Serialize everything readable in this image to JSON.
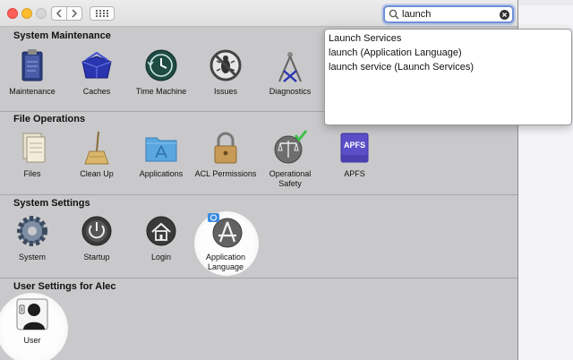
{
  "search": {
    "value": "launch"
  },
  "suggestions": [
    "Launch Services",
    "launch (Application Language)",
    "launch service (Launch Services)"
  ],
  "sections": [
    {
      "title": "System Maintenance",
      "items": [
        {
          "label": "Maintenance",
          "icon": "clipboard-icon"
        },
        {
          "label": "Caches",
          "icon": "caches-box-icon"
        },
        {
          "label": "Time Machine",
          "icon": "time-machine-icon"
        },
        {
          "label": "Issues",
          "icon": "issues-no-bug-icon"
        },
        {
          "label": "Diagnostics",
          "icon": "diagnostics-caliper-icon"
        }
      ]
    },
    {
      "title": "File Operations",
      "items": [
        {
          "label": "Files",
          "icon": "files-icon"
        },
        {
          "label": "Clean Up",
          "icon": "broom-icon"
        },
        {
          "label": "Applications",
          "icon": "applications-folder-icon"
        },
        {
          "label": "ACL Permissions",
          "icon": "padlock-icon"
        },
        {
          "label": "Operational Safety",
          "icon": "scales-check-icon"
        },
        {
          "label": "APFS",
          "icon": "apfs-drive-icon",
          "badge": "APFS"
        }
      ]
    },
    {
      "title": "System Settings",
      "items": [
        {
          "label": "System",
          "icon": "gear-icon"
        },
        {
          "label": "Startup",
          "icon": "power-icon"
        },
        {
          "label": "Login",
          "icon": "home-icon"
        },
        {
          "label": "Application Language",
          "icon": "app-store-language-icon"
        }
      ]
    },
    {
      "title": "User Settings for Alec",
      "items": [
        {
          "label": "User",
          "icon": "user-silhouette-icon"
        }
      ]
    }
  ],
  "colors": {
    "window_bg": "#c9c9cb",
    "search_focus": "#6f8fd8",
    "close": "#ff5f57",
    "minimize": "#febc2e",
    "check_green": "#3ec04a"
  }
}
